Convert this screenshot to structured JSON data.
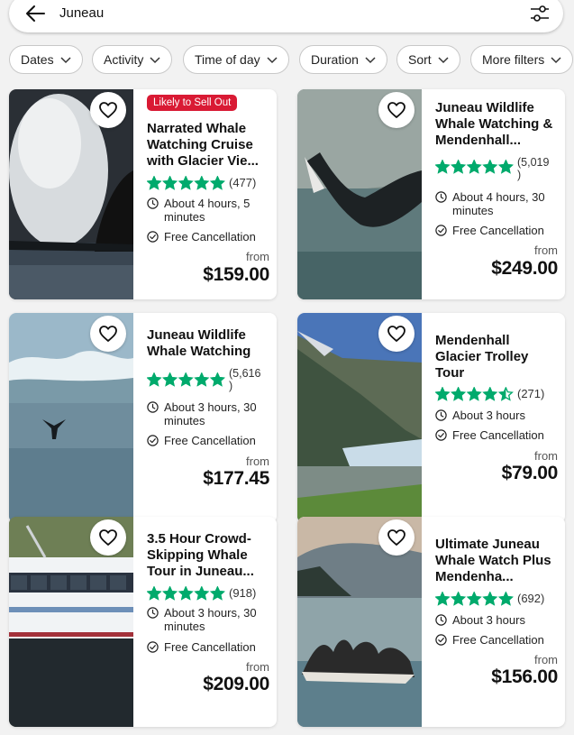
{
  "search": {
    "query": "Juneau",
    "back_icon": "arrow-left-icon",
    "filter_icon": "sliders-icon"
  },
  "filters": [
    {
      "label": "Dates"
    },
    {
      "label": "Activity"
    },
    {
      "label": "Time of day"
    },
    {
      "label": "Duration"
    },
    {
      "label": "Sort"
    },
    {
      "label": "More filters"
    }
  ],
  "colors": {
    "badge": "#d91a34",
    "star": "#00aa6c"
  },
  "cards": [
    {
      "badge": "Likely to Sell Out",
      "title": "Narrated Whale Watching Cruise with Glacier Vie...",
      "rating": 5,
      "reviews": "(477)",
      "duration": "About 4 hours, 5 minutes",
      "cancellation": "Free Cancellation",
      "from": "from",
      "price": "$159.00"
    },
    {
      "title": "Juneau Wildlife Whale Watching & Mendenhall...",
      "rating": 5,
      "reviews": "(5,019 )",
      "duration": "About 4 hours, 30 minutes",
      "cancellation": "Free Cancellation",
      "from": "from",
      "price": "$249.00"
    },
    {
      "title": "Juneau Wildlife Whale Watching",
      "rating": 5,
      "reviews": "(5,616 )",
      "duration": "About 3 hours, 30 minutes",
      "cancellation": "Free Cancellation",
      "from": "from",
      "price": "$177.45"
    },
    {
      "title": "Mendenhall Glacier Trolley Tour",
      "rating": 4.5,
      "reviews": "(271)",
      "duration": "About 3 hours",
      "cancellation": "Free Cancellation",
      "from": "from",
      "price": "$79.00"
    },
    {
      "title": "3.5 Hour Crowd-Skipping Whale Tour in Juneau...",
      "rating": 5,
      "reviews": "(918)",
      "duration": "About 3 hours, 30 minutes",
      "cancellation": "Free Cancellation",
      "from": "from",
      "price": "$209.00"
    },
    {
      "title": "Ultimate Juneau Whale Watch Plus Mendenha...",
      "rating": 5,
      "reviews": "(692)",
      "duration": "About 3 hours",
      "cancellation": "Free Cancellation",
      "from": "from",
      "price": "$156.00"
    }
  ]
}
